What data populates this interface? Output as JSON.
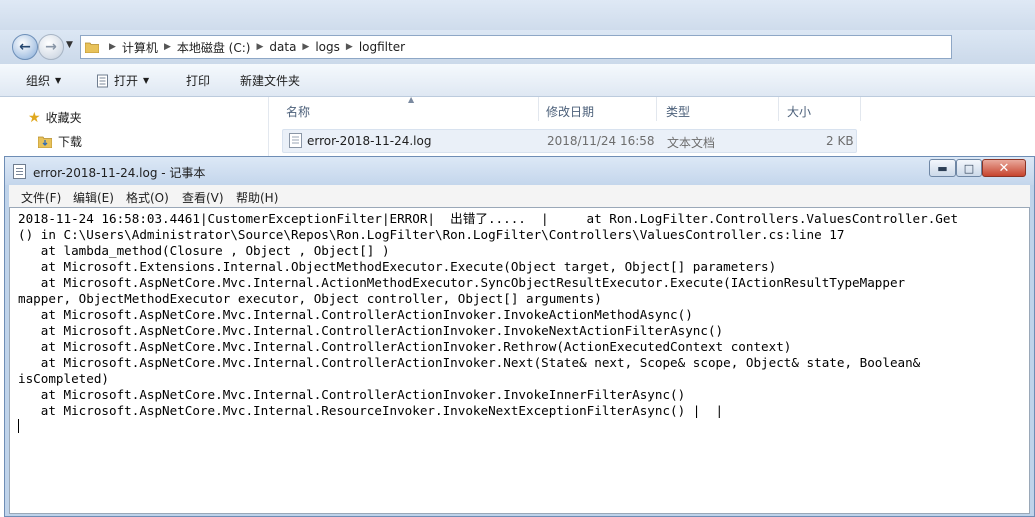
{
  "explorer": {
    "breadcrumbs": [
      "计算机",
      "本地磁盘 (C:)",
      "data",
      "logs",
      "logfilter"
    ],
    "toolbar": {
      "organize_label": "组织",
      "open_label": "打开",
      "print_label": "打印",
      "new_folder_label": "新建文件夹"
    },
    "nav_pane": {
      "favorites_label": "收藏夹",
      "downloads_label": "下载"
    },
    "columns": {
      "name": "名称",
      "modified": "修改日期",
      "type": "类型",
      "size": "大小"
    },
    "files": [
      {
        "name": "error-2018-11-24.log",
        "modified": "2018/11/24 16:58",
        "type": "文本文档",
        "size": "2 KB"
      }
    ]
  },
  "notepad": {
    "title": "error-2018-11-24.log - 记事本",
    "menu": [
      "文件(F)",
      "编辑(E)",
      "格式(O)",
      "查看(V)",
      "帮助(H)"
    ],
    "content_lines": [
      "2018-11-24 16:58:03.4461|CustomerExceptionFilter|ERROR|  出错了.....  |     at Ron.LogFilter.Controllers.ValuesController.Get",
      "() in C:\\Users\\Administrator\\Source\\Repos\\Ron.LogFilter\\Ron.LogFilter\\Controllers\\ValuesController.cs:line 17",
      "   at lambda_method(Closure , Object , Object[] )",
      "   at Microsoft.Extensions.Internal.ObjectMethodExecutor.Execute(Object target, Object[] parameters)",
      "   at Microsoft.AspNetCore.Mvc.Internal.ActionMethodExecutor.SyncObjectResultExecutor.Execute(IActionResultTypeMapper",
      "mapper, ObjectMethodExecutor executor, Object controller, Object[] arguments)",
      "   at Microsoft.AspNetCore.Mvc.Internal.ControllerActionInvoker.InvokeActionMethodAsync()",
      "   at Microsoft.AspNetCore.Mvc.Internal.ControllerActionInvoker.InvokeNextActionFilterAsync()",
      "   at Microsoft.AspNetCore.Mvc.Internal.ControllerActionInvoker.Rethrow(ActionExecutedContext context)",
      "   at Microsoft.AspNetCore.Mvc.Internal.ControllerActionInvoker.Next(State& next, Scope& scope, Object& state, Boolean&",
      "isCompleted)",
      "   at Microsoft.AspNetCore.Mvc.Internal.ControllerActionInvoker.InvokeInnerFilterAsync()",
      "   at Microsoft.AspNetCore.Mvc.Internal.ResourceInvoker.InvokeNextExceptionFilterAsync() |  |"
    ]
  }
}
